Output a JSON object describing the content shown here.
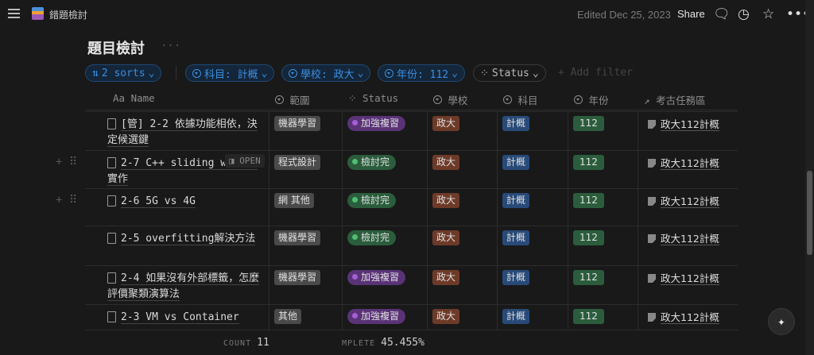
{
  "topbar": {
    "breadcrumb": "錯題檢討",
    "edited": "Edited Dec 25, 2023",
    "share": "Share",
    "icons": [
      "comment-icon",
      "clock-icon",
      "star-icon",
      "more-icon"
    ]
  },
  "page": {
    "title": "題目檢討"
  },
  "filters": {
    "sorts": "2 sorts",
    "subject": "科目: 計概",
    "school": "學校: 政大",
    "year": "年份: 112",
    "status": "Status",
    "add_filter": "+ Add filter"
  },
  "columns": [
    "Aa Name",
    "範圍",
    "Status",
    "學校",
    "科目",
    "年份",
    "考古任務區"
  ],
  "rows": [
    {
      "name": "[管] 2-2 依據功能相依，決定候選鍵",
      "range": "機器學習",
      "status": "加強複習",
      "school": "政大",
      "subject": "計概",
      "year": "112",
      "relation": "政大112計概"
    },
    {
      "name": "2-7 C++ sliding window實作",
      "range": "程式設計",
      "status": "檢討完",
      "school": "政大",
      "subject": "計概",
      "year": "112",
      "relation": "政大112計概",
      "open": "OPEN"
    },
    {
      "name": "2-6 5G vs 4G",
      "range": "網 其他",
      "status": "檢討完",
      "school": "政大",
      "subject": "計概",
      "year": "112",
      "relation": "政大112計概"
    },
    {
      "name": "2-5 overfitting解決方法",
      "range": "機器學習",
      "status": "檢討完",
      "school": "政大",
      "subject": "計概",
      "year": "112",
      "relation": "政大112計概"
    },
    {
      "name": "2-4 如果沒有外部標籤，怎麼評價聚類演算法",
      "range": "機器學習",
      "status": "加強複習",
      "school": "政大",
      "subject": "計概",
      "year": "112",
      "relation": "政大112計概"
    },
    {
      "name": "2-3 VM vs Container",
      "range": "其他",
      "status": "加強複習",
      "school": "政大",
      "subject": "計概",
      "year": "112",
      "relation": "政大112計概"
    }
  ],
  "footer": {
    "count_label": "COUNT",
    "count": "11",
    "complete_label": "MPLETE",
    "complete": "45.455%"
  },
  "colors": {
    "加強複習": "#5a3377",
    "加強複習_dot": "#a55fd6",
    "檢討完": "#2b5d3d",
    "檢討完_dot": "#4fbf6f",
    "school": "#6e3a28",
    "subject": "#284a78",
    "year": "#2b5d3d",
    "range": "#4a4a4a"
  }
}
